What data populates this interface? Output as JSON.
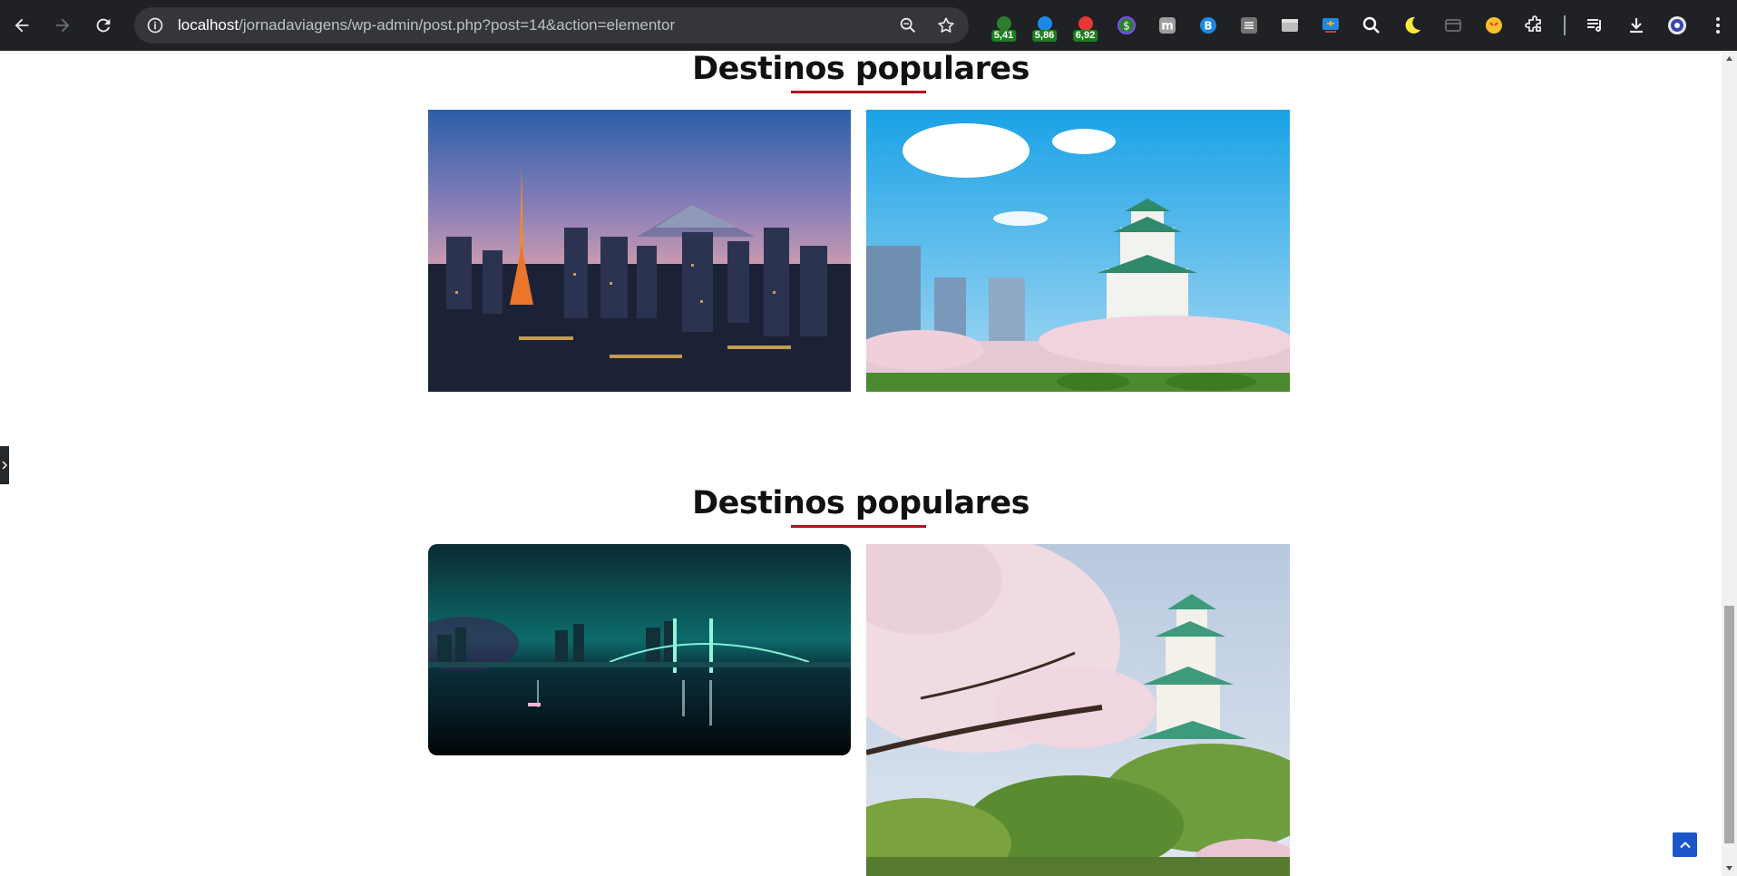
{
  "browser": {
    "url_host": "localhost",
    "url_path": "/jornadaviagens/wp-admin/post.php?post=14&action=elementor",
    "extensions": [
      {
        "name": "extension-1",
        "badge": "5,41",
        "color": "#2e7d32"
      },
      {
        "name": "extension-2",
        "badge": "5,86",
        "color": "#1e88e5"
      },
      {
        "name": "extension-3",
        "badge": "6,92",
        "color": "#e53935"
      }
    ]
  },
  "sections": [
    {
      "title": "Destinos populares"
    },
    {
      "title": "Destinos populares"
    }
  ],
  "colors": {
    "chrome_bg": "#202124",
    "omnibox_bg": "#35363a",
    "title_underline": "#b0121b",
    "to_top_button": "#1a56c8"
  }
}
